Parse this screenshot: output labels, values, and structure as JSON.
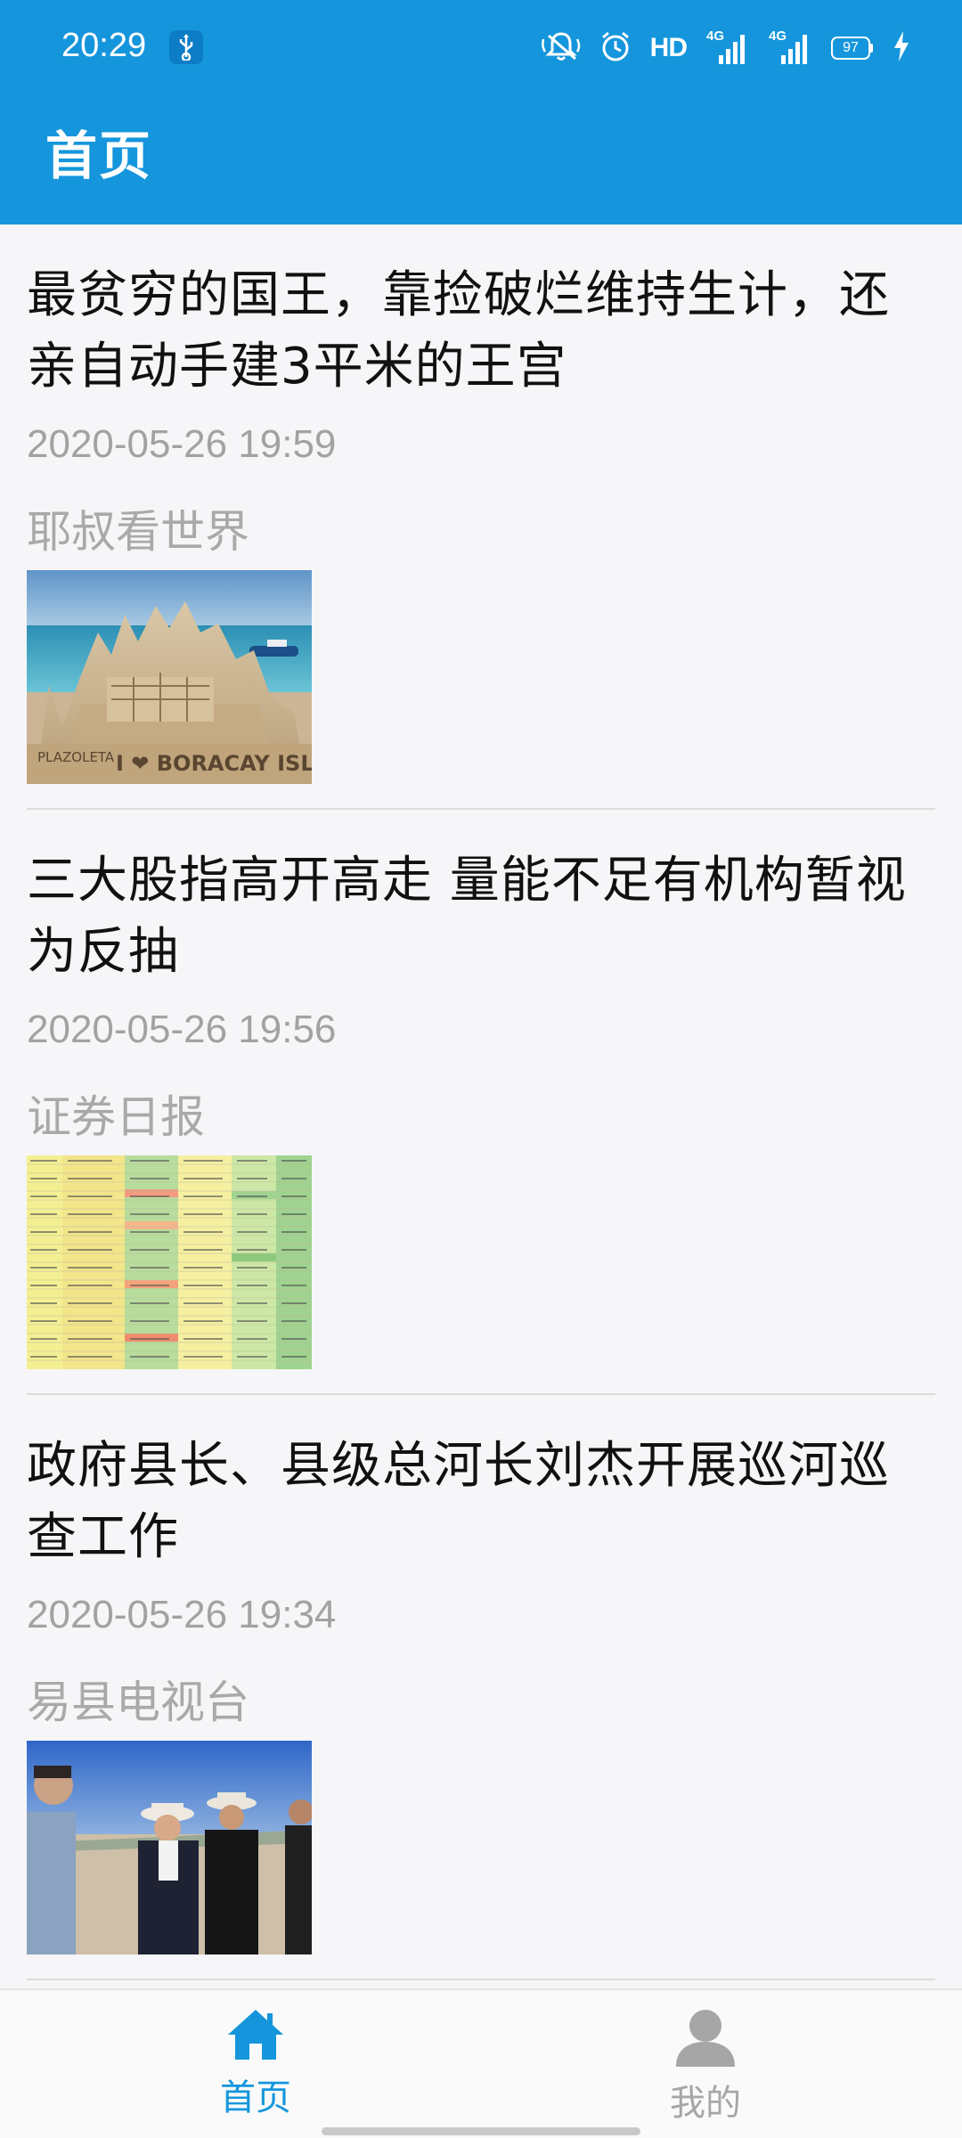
{
  "status_bar": {
    "time": "20:29",
    "hd_label": "HD",
    "sim1_label": "4G",
    "sim2_label": "4G",
    "battery": "97",
    "icons": [
      "usb-icon",
      "mute-icon",
      "alarm-icon",
      "signal-icon",
      "signal-icon",
      "battery-icon",
      "charging-icon"
    ]
  },
  "header": {
    "title": "首页",
    "background": "#1596dc"
  },
  "articles": [
    {
      "title": "最贫穷的国王，靠捡破烂维持生计，还亲自动手建3平米的王宫",
      "time": "2020-05-26 19:59",
      "source": "耶叔看世界",
      "thumb_caption": "I ❤ BORACAY ISLAND",
      "thumb_caption2": "PLAZOLETA"
    },
    {
      "title": "三大股指高开高走 量能不足有机构暂视为反抽",
      "time": "2020-05-26 19:56",
      "source": "证券日报"
    },
    {
      "title": "政府县长、县级总河长刘杰开展巡河巡查工作",
      "time": "2020-05-26 19:34",
      "source": "易县电视台"
    }
  ],
  "bottom_nav": {
    "items": [
      {
        "label": "首页",
        "icon": "home-icon",
        "active": true
      },
      {
        "label": "我的",
        "icon": "person-icon",
        "active": false
      }
    ],
    "active_color": "#1596dc",
    "inactive_color": "#a6a6a6"
  }
}
